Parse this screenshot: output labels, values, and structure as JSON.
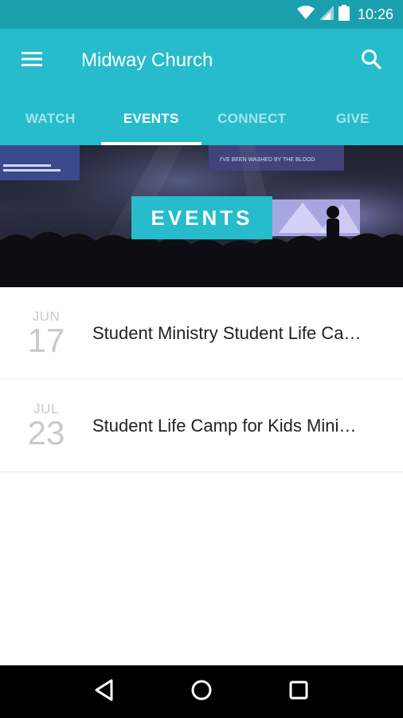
{
  "status_bar": {
    "time": "10:26",
    "icons": [
      "wifi-icon",
      "signal-icon",
      "battery-icon"
    ]
  },
  "app_bar": {
    "title": "Midway Church",
    "menu_icon": "menu-icon",
    "search_icon": "search-icon",
    "color": "#26bccb"
  },
  "tabs": [
    {
      "label": "WATCH",
      "active": false
    },
    {
      "label": "EVENTS",
      "active": true
    },
    {
      "label": "CONNECT",
      "active": false
    },
    {
      "label": "GIVE",
      "active": false
    }
  ],
  "hero": {
    "badge_text": "EVENTS",
    "screen_text": "I'VE BEEN WASHED BY THE BLOOD"
  },
  "events": [
    {
      "month": "JUN",
      "day": "17",
      "title": "Student Ministry Student Life Ca…"
    },
    {
      "month": "JUL",
      "day": "23",
      "title": "Student Life Camp for Kids Mini…"
    }
  ],
  "nav_bar": {
    "icons": [
      "back-icon",
      "home-icon",
      "recents-icon"
    ]
  }
}
